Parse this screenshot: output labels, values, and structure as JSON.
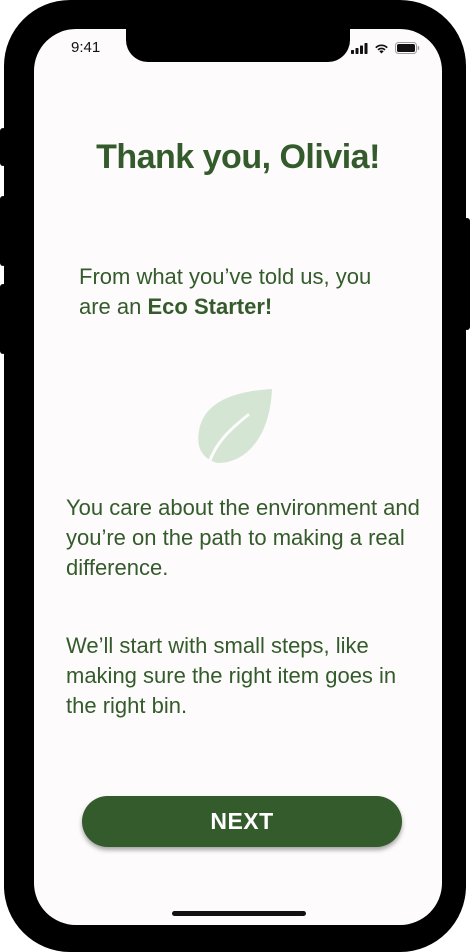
{
  "status_bar": {
    "time": "9:41"
  },
  "icons": {
    "signal": "cellular-signal-icon",
    "wifi": "wifi-icon",
    "battery": "battery-icon",
    "leaf": "leaf-icon"
  },
  "content": {
    "title": "Thank you, Olivia!",
    "intro_prefix": "From what you’ve told us, you are an ",
    "intro_level": "Eco Starter!",
    "paragraph_1": "You care about the environment and you’re on the path to making a real difference.",
    "paragraph_2": "We’ll start with small steps, like making sure the right item goes in the right bin."
  },
  "actions": {
    "next_label": "NEXT"
  },
  "colors": {
    "primary_green": "#345b2b",
    "leaf_green": "#d5e5d3",
    "screen_bg": "#fdfbfb",
    "frame": "#000000"
  }
}
